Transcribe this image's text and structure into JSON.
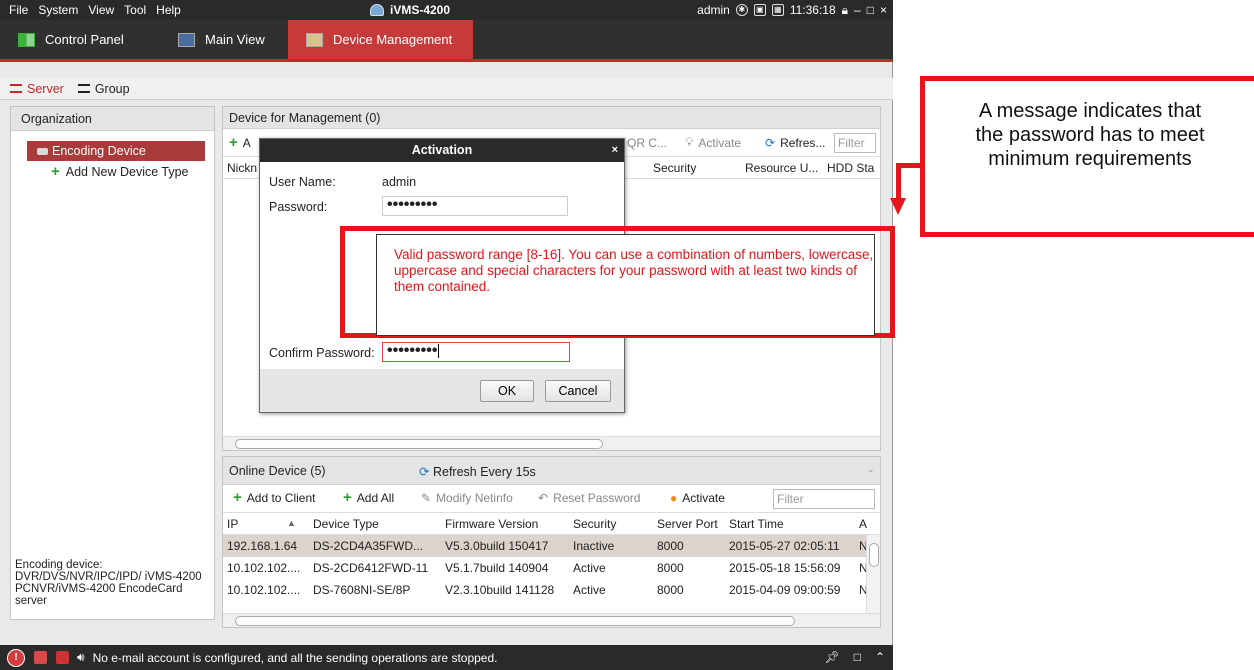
{
  "titlebar": {
    "menu": [
      "File",
      "System",
      "View",
      "Tool",
      "Help"
    ],
    "app_title": "iVMS-4200",
    "user": "admin",
    "clock": "11:36:18"
  },
  "main_tabs": [
    "Control Panel",
    "Main View",
    "Device Management"
  ],
  "sub_tabs": [
    "Server",
    "Group"
  ],
  "organization": {
    "header": "Organization",
    "selected_item": "Encoding Device",
    "add_item": "Add New Device Type",
    "footer": "Encoding device: DVR/DVS/NVR/IPC/IPD/ iVMS-4200 PCNVR/iVMS-4200 EncodeCard server"
  },
  "device_management": {
    "header": "Device for Management (0)",
    "toolbar_left": "A",
    "toolbar_qr": "QR C...",
    "toolbar_activate": "Activate",
    "toolbar_refresh": "Refres...",
    "filter_placeholder": "Filter",
    "columns": {
      "nickname": "Nickn",
      "security": "Security",
      "resource": "Resource U...",
      "hdd": "HDD Sta"
    }
  },
  "online_device": {
    "header": "Online Device (5)",
    "refresh": "Refresh Every 15s",
    "toolbar": {
      "add_to_client": "Add to Client",
      "add_all": "Add All",
      "modify_netinfo": "Modify Netinfo",
      "reset_password": "Reset Password",
      "activate": "Activate",
      "filter_placeholder": "Filter"
    },
    "columns": [
      "IP",
      "Device Type",
      "Firmware Version",
      "Security",
      "Server Port",
      "Start Time",
      "A"
    ],
    "rows": [
      {
        "ip": "192.168.1.64",
        "type": "DS-2CD4A35FWD...",
        "fw": "V5.3.0build 150417",
        "sec": "Inactive",
        "port": "8000",
        "start": "2015-05-27 02:05:11",
        "a": "N"
      },
      {
        "ip": "10.102.102....",
        "type": "DS-2CD6412FWD-11",
        "fw": "V5.1.7build 140904",
        "sec": "Active",
        "port": "8000",
        "start": "2015-05-18 15:56:09",
        "a": "N"
      },
      {
        "ip": "10.102.102....",
        "type": "DS-7608NI-SE/8P",
        "fw": "V2.3.10build 141128",
        "sec": "Active",
        "port": "8000",
        "start": "2015-04-09 09:00:59",
        "a": "N"
      }
    ]
  },
  "status_message": "No e-mail account is configured, and all the sending operations are stopped.",
  "dialog": {
    "title": "Activation",
    "username_label": "User Name:",
    "username_value": "admin",
    "password_label": "Password:",
    "password_value": "•••••••••",
    "confirm_label": "Confirm Password:",
    "confirm_value": "•••••••••",
    "ok": "OK",
    "cancel": "Cancel"
  },
  "tooltip": "Valid password range [8-16]. You can use a combination of numbers, lowercase, uppercase and special characters for your password with at least two kinds of them contained.",
  "annotation": "A message indicates that the password has to meet minimum requirements",
  "colors": {
    "accent_red": "#c73a3a",
    "highlight_red": "#e8141c",
    "dark_bar": "#2a2a2a",
    "green": "#2f9b2f",
    "blue": "#1f75c8",
    "orange": "#f08a1c"
  }
}
